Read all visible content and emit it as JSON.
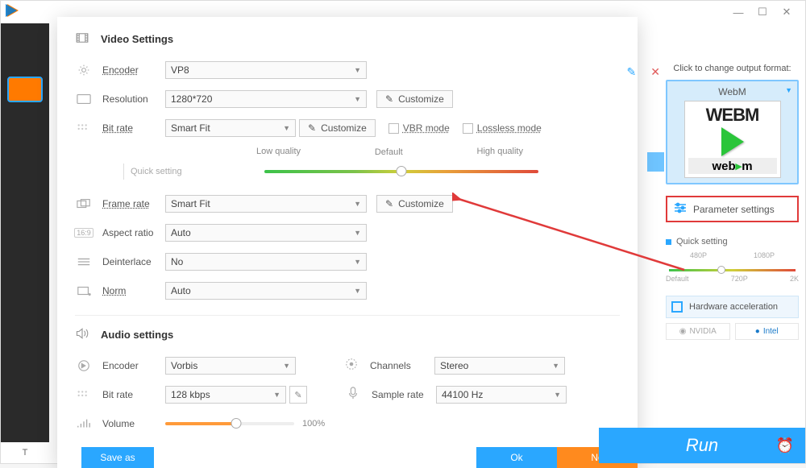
{
  "window": {
    "min": "—",
    "max": "☐",
    "close": "✕"
  },
  "toolbar": {
    "edit_icon": "✎",
    "close_icon": "✕"
  },
  "video": {
    "title": "Video Settings",
    "encoder": {
      "label": "Encoder",
      "value": "VP8"
    },
    "resolution": {
      "label": "Resolution",
      "value": "1280*720",
      "customize": "Customize"
    },
    "bitrate": {
      "label": "Bit rate",
      "value": "Smart Fit",
      "customize": "Customize",
      "vbr": "VBR mode",
      "lossless": "Lossless mode"
    },
    "quick_setting_label": "Quick setting",
    "q_low": "Low quality",
    "q_def": "Default",
    "q_high": "High quality",
    "framerate": {
      "label": "Frame rate",
      "value": "Smart Fit",
      "customize": "Customize"
    },
    "aspect": {
      "label": "Aspect ratio",
      "value": "Auto"
    },
    "deinterlace": {
      "label": "Deinterlace",
      "value": "No"
    },
    "norm": {
      "label": "Norm",
      "value": "Auto"
    }
  },
  "audio": {
    "title": "Audio settings",
    "encoder": {
      "label": "Encoder",
      "value": "Vorbis"
    },
    "bitrate": {
      "label": "Bit rate",
      "value": "128 kbps"
    },
    "channels": {
      "label": "Channels",
      "value": "Stereo"
    },
    "samplerate": {
      "label": "Sample rate",
      "value": "44100 Hz"
    },
    "volume": {
      "label": "Volume",
      "pct": "100%"
    }
  },
  "footer": {
    "save": "Save as",
    "ok": "Ok",
    "no": "No"
  },
  "right": {
    "click_title": "Click to change output format:",
    "format_name": "WebM",
    "logo_big": "WEBM",
    "logo_small_a": "web",
    "logo_small_b": "m",
    "param_btn": "Parameter settings",
    "qs_title": "Quick setting",
    "ticks_top": [
      "480P",
      "1080P"
    ],
    "ticks_bot": [
      "Default",
      "720P",
      "2K"
    ],
    "hw": "Hardware acceleration",
    "nvidia": "NVIDIA",
    "intel": "Intel"
  },
  "run": "Run"
}
